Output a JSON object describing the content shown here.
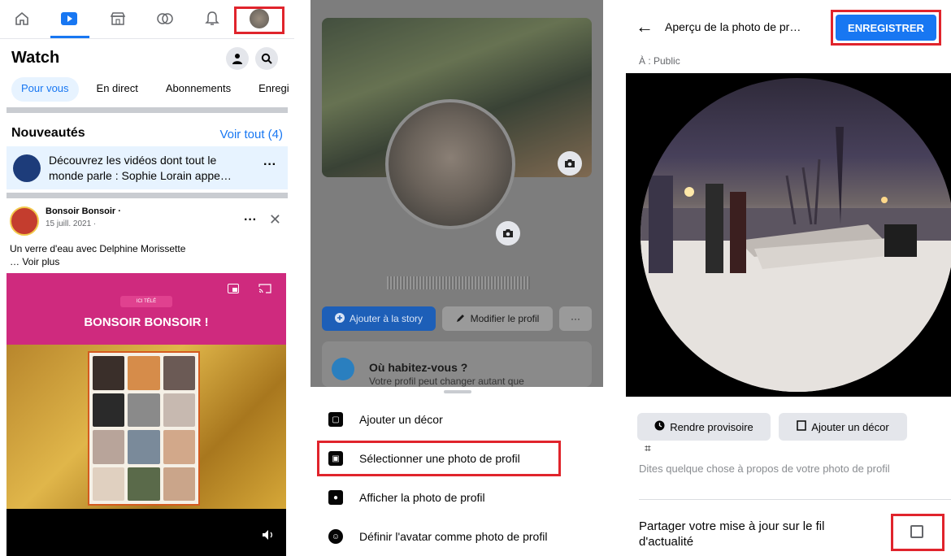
{
  "panel1": {
    "title": "Watch",
    "tabs": [
      "Pour vous",
      "En direct",
      "Abonnements",
      "Enregi"
    ],
    "section_title": "Nouveautés",
    "voir_tout": "Voir tout (4)",
    "notification_text": "Découvrez les vidéos dont tout le monde parle : Sophie Lorain appe…",
    "post": {
      "author": "Bonsoir Bonsoir ·",
      "date": "15 juill. 2021 ·",
      "caption_line1": "Un verre d'eau avec Delphine Morissette",
      "caption_line2": "… Voir plus"
    },
    "video": {
      "brand": "ICI TÉLÉ",
      "title": "BONSOIR BONSOIR !"
    }
  },
  "panel2": {
    "btn_story": "Ajouter à la story",
    "btn_edit": "Modifier le profil",
    "btn_more": "···",
    "where_title": "Où habitez-vous ?",
    "where_sub": "Votre profil peut changer autant que",
    "menu": [
      {
        "label": "Ajouter un décor"
      },
      {
        "label": "Sélectionner une photo de profil"
      },
      {
        "label": "Afficher la photo de profil"
      },
      {
        "label": "Définir l'avatar comme photo de profil"
      }
    ]
  },
  "panel3": {
    "title": "Aperçu de la photo de pr…",
    "save": "ENREGISTRER",
    "audience": "À : Public",
    "btn_temp": "Rendre provisoire",
    "btn_frame": "Ajouter un décor",
    "placeholder": "Dites quelque chose à propos de votre photo de profil",
    "share_label": "Partager votre mise à jour sur le fil d'actualité",
    "share_checked": false
  },
  "colors": {
    "accent": "#1877f2",
    "highlight_box": "#e0242c",
    "video_pink": "#cf2a7e"
  }
}
